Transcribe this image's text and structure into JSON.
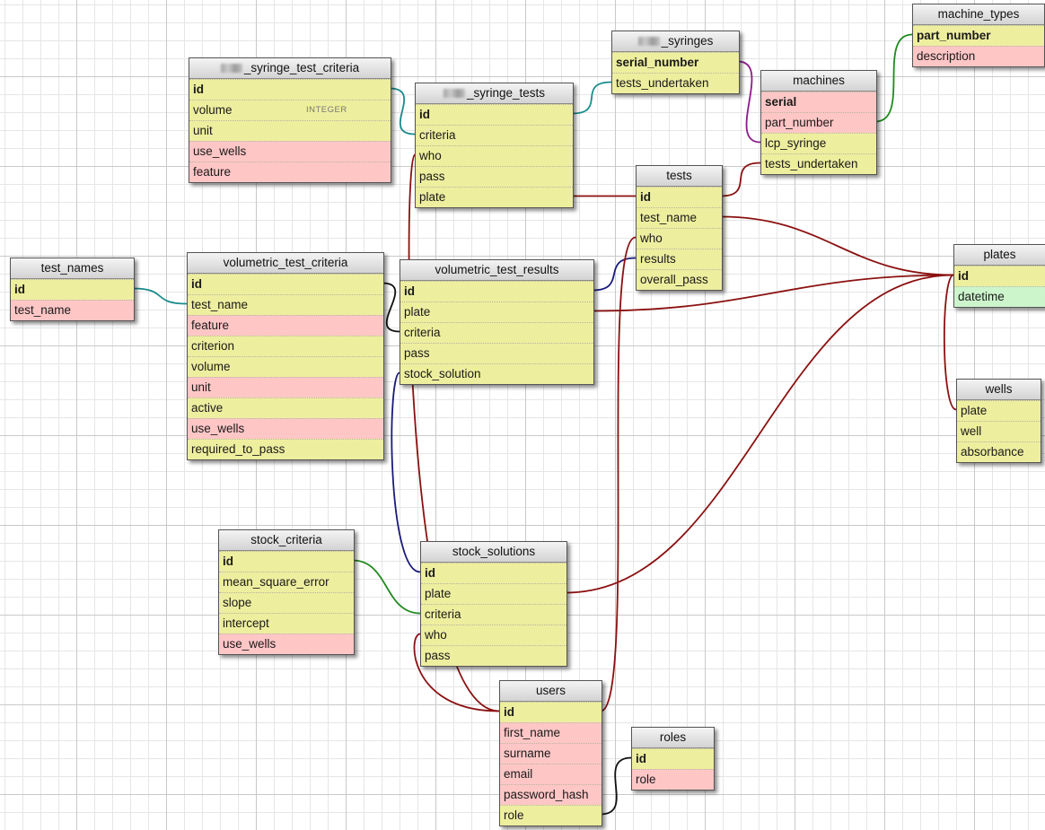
{
  "tables": [
    {
      "id": "machine_types",
      "title": "machine_types",
      "fields": [
        {
          "name": "part_number",
          "color": "yellow",
          "pk": true
        },
        {
          "name": "description",
          "color": "pink"
        }
      ]
    },
    {
      "id": "syringes",
      "title": "_syringes",
      "redacted_prefix": true,
      "fields": [
        {
          "name": "serial_number",
          "color": "yellow",
          "pk": true
        },
        {
          "name": "tests_undertaken",
          "color": "yellow"
        }
      ]
    },
    {
      "id": "machines",
      "title": "machines",
      "fields": [
        {
          "name": "serial",
          "color": "pink",
          "pk": true
        },
        {
          "name": "part_number",
          "color": "pink"
        },
        {
          "name": "lcp_syringe",
          "color": "yellow"
        },
        {
          "name": "tests_undertaken",
          "color": "yellow"
        }
      ]
    },
    {
      "id": "syringe_test_criteria",
      "title": "_syringe_test_criteria",
      "redacted_prefix": true,
      "fields": [
        {
          "name": "id",
          "color": "yellow",
          "pk": true
        },
        {
          "name": "volume",
          "color": "yellow",
          "type": "INTEGER"
        },
        {
          "name": "unit",
          "color": "yellow"
        },
        {
          "name": "use_wells",
          "color": "pink"
        },
        {
          "name": "feature",
          "color": "pink"
        }
      ]
    },
    {
      "id": "syringe_tests",
      "title": "_syringe_tests",
      "redacted_prefix": true,
      "fields": [
        {
          "name": "id",
          "color": "yellow",
          "pk": true
        },
        {
          "name": "criteria",
          "color": "yellow"
        },
        {
          "name": "who",
          "color": "yellow"
        },
        {
          "name": "pass",
          "color": "yellow"
        },
        {
          "name": "plate",
          "color": "yellow"
        }
      ]
    },
    {
      "id": "tests",
      "title": "tests",
      "fields": [
        {
          "name": "id",
          "color": "yellow",
          "pk": true
        },
        {
          "name": "test_name",
          "color": "yellow"
        },
        {
          "name": "who",
          "color": "yellow"
        },
        {
          "name": "results",
          "color": "yellow"
        },
        {
          "name": "overall_pass",
          "color": "yellow"
        }
      ]
    },
    {
      "id": "plates",
      "title": "plates",
      "fields": [
        {
          "name": "id",
          "color": "yellow",
          "pk": true
        },
        {
          "name": "datetime",
          "color": "green"
        }
      ]
    },
    {
      "id": "wells",
      "title": "wells",
      "fields": [
        {
          "name": "plate",
          "color": "yellow"
        },
        {
          "name": "well",
          "color": "yellow"
        },
        {
          "name": "absorbance",
          "color": "yellow"
        }
      ]
    },
    {
      "id": "test_names",
      "title": "test_names",
      "fields": [
        {
          "name": "id",
          "color": "yellow",
          "pk": true
        },
        {
          "name": "test_name",
          "color": "pink"
        }
      ]
    },
    {
      "id": "volumetric_test_criteria",
      "title": "volumetric_test_criteria",
      "fields": [
        {
          "name": "id",
          "color": "yellow",
          "pk": true
        },
        {
          "name": "test_name",
          "color": "yellow"
        },
        {
          "name": "feature",
          "color": "pink"
        },
        {
          "name": "criterion",
          "color": "yellow"
        },
        {
          "name": "volume",
          "color": "yellow"
        },
        {
          "name": "unit",
          "color": "pink"
        },
        {
          "name": "active",
          "color": "yellow"
        },
        {
          "name": "use_wells",
          "color": "pink"
        },
        {
          "name": "required_to_pass",
          "color": "yellow"
        }
      ]
    },
    {
      "id": "volumetric_test_results",
      "title": "volumetric_test_results",
      "fields": [
        {
          "name": "id",
          "color": "yellow",
          "pk": true
        },
        {
          "name": "plate",
          "color": "yellow"
        },
        {
          "name": "criteria",
          "color": "yellow"
        },
        {
          "name": "pass",
          "color": "yellow"
        },
        {
          "name": "stock_solution",
          "color": "yellow"
        }
      ]
    },
    {
      "id": "stock_criteria",
      "title": "stock_criteria",
      "fields": [
        {
          "name": "id",
          "color": "yellow",
          "pk": true
        },
        {
          "name": "mean_square_error",
          "color": "yellow"
        },
        {
          "name": "slope",
          "color": "yellow"
        },
        {
          "name": "intercept",
          "color": "yellow"
        },
        {
          "name": "use_wells",
          "color": "pink"
        }
      ]
    },
    {
      "id": "stock_solutions",
      "title": "stock_solutions",
      "fields": [
        {
          "name": "id",
          "color": "yellow",
          "pk": true
        },
        {
          "name": "plate",
          "color": "yellow"
        },
        {
          "name": "criteria",
          "color": "yellow"
        },
        {
          "name": "who",
          "color": "yellow"
        },
        {
          "name": "pass",
          "color": "yellow"
        }
      ]
    },
    {
      "id": "users",
      "title": "users",
      "fields": [
        {
          "name": "id",
          "color": "yellow",
          "pk": true
        },
        {
          "name": "first_name",
          "color": "pink"
        },
        {
          "name": "surname",
          "color": "pink"
        },
        {
          "name": "email",
          "color": "pink"
        },
        {
          "name": "password_hash",
          "color": "pink"
        },
        {
          "name": "role",
          "color": "yellow"
        }
      ]
    },
    {
      "id": "roles",
      "title": "roles",
      "fields": [
        {
          "name": "id",
          "color": "yellow",
          "pk": true
        },
        {
          "name": "role",
          "color": "pink"
        }
      ]
    }
  ],
  "relations": [
    {
      "from": "machines.part_number",
      "to": "machine_types.part_number",
      "color": "#1f8a1f"
    },
    {
      "from": "machines.lcp_syringe",
      "to": "syringes.serial_number",
      "color": "#8b1a8b"
    },
    {
      "from": "syringes.tests_undertaken",
      "to": "syringe_tests.id",
      "color": "#1a8b8b"
    },
    {
      "from": "syringe_tests.criteria",
      "to": "syringe_test_criteria.id",
      "color": "#1a8b8b"
    },
    {
      "from": "machines.tests_undertaken",
      "to": "tests.id",
      "color": "#8b1111"
    },
    {
      "from": "syringe_tests.plate",
      "to": "tests.id",
      "color": "#8b1111"
    },
    {
      "from": "tests.test_name",
      "to": "plates.id",
      "color": "#8b1111"
    },
    {
      "from": "volumetric_test_results.plate",
      "to": "plates.id",
      "color": "#8b1111"
    },
    {
      "from": "tests.results",
      "to": "volumetric_test_results.id",
      "color": "#1a1a7a"
    },
    {
      "from": "plates.id",
      "to": "wells.plate",
      "color": "#8b1111"
    },
    {
      "from": "stock_solutions.plate",
      "to": "plates.id",
      "color": "#8b1111"
    },
    {
      "from": "test_names.id",
      "to": "volumetric_test_criteria.test_name",
      "color": "#1a8b8b"
    },
    {
      "from": "volumetric_test_results.criteria",
      "to": "volumetric_test_criteria.id",
      "color": "#111111"
    },
    {
      "from": "volumetric_test_results.stock_solution",
      "to": "stock_solutions.id",
      "color": "#1a1a7a"
    },
    {
      "from": "stock_criteria.id",
      "to": "stock_solutions.criteria",
      "color": "#1f8a1f"
    },
    {
      "from": "syringe_tests.who",
      "to": "users.id",
      "color": "#8b1111"
    },
    {
      "from": "tests.who",
      "to": "users.id",
      "color": "#8b1111"
    },
    {
      "from": "stock_solutions.who",
      "to": "users.id",
      "color": "#8b1111"
    },
    {
      "from": "users.role",
      "to": "roles.id",
      "color": "#111111"
    }
  ]
}
